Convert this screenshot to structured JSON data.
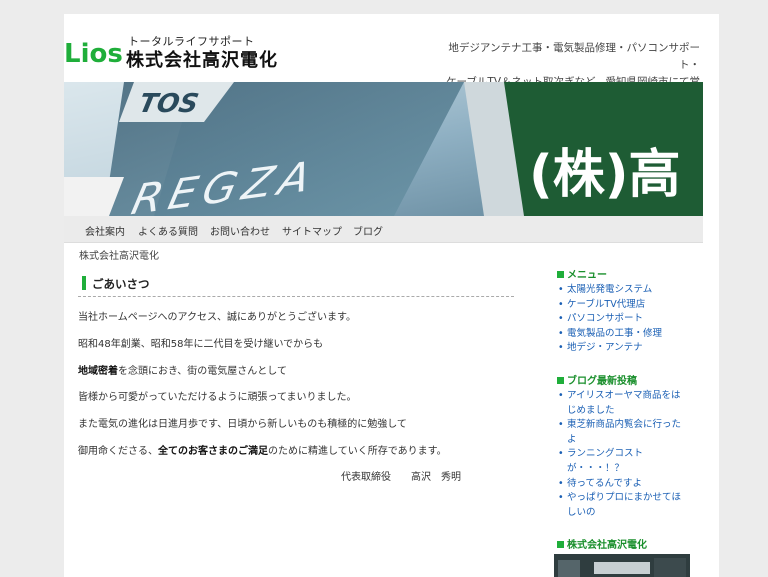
{
  "header": {
    "logo_text": "Lios",
    "subtitle": "トータルライフサポート",
    "company": "株式会社高沢電化",
    "tagline_line1": "地デジアンテナ工事・電気製品修理・パソコンサポート・",
    "tagline_line2": "ケーブルTV＆ネット取次ぎなど、愛知県岡崎市にて営業。"
  },
  "banner": {
    "sign_top": "TOS",
    "sign_brand": "REGZA",
    "sign_kanji": "(株)高"
  },
  "nav": {
    "items": [
      "会社案内",
      "よくある質問",
      "お問い合わせ",
      "サイトマップ",
      "ブログ"
    ]
  },
  "breadcrumb": "株式会社高沢電化",
  "main": {
    "heading": "ごあいさつ",
    "p1": "当社ホームページへのアクセス、誠にありがとうございます。",
    "p2": "昭和48年創業、昭和58年に二代目を受け継いでからも",
    "p3_bold": "地域密着",
    "p3_rest": "を念頭におき、街の電気屋さんとして",
    "p4": "皆様から可愛がっていただけるように頑張ってまいりました。",
    "p5": "また電気の進化は日進月歩です、日頃から新しいものも積極的に勉強して",
    "p6_pre": "御用命くださる、",
    "p6_bold": "全てのお客さまのご満足",
    "p6_post": "のために精進していく所存であります。",
    "signature": "代表取締役　　高沢　秀明"
  },
  "sidebar": {
    "menu_heading": "メニュー",
    "menu_items": [
      "太陽光発電システム",
      "ケーブルTV代理店",
      "パソコンサポート",
      "電気製品の工事・修理",
      "地デジ・アンテナ"
    ],
    "blog_heading": "ブログ最新投稿",
    "blog_items": [
      "アイリスオーヤマ商品をは",
      "じめました",
      "東芝新商品内覧会に行った",
      "よ",
      "ランニングコスト",
      "が・・・！？",
      "待ってるんですよ",
      "やっぱりプロにまかせてほ",
      "しいの"
    ],
    "company_heading": "株式会社高沢電化"
  },
  "colors": {
    "accent_green": "#1fae3a",
    "link_blue": "#1a5fb4",
    "page_bg": "#ececec"
  }
}
